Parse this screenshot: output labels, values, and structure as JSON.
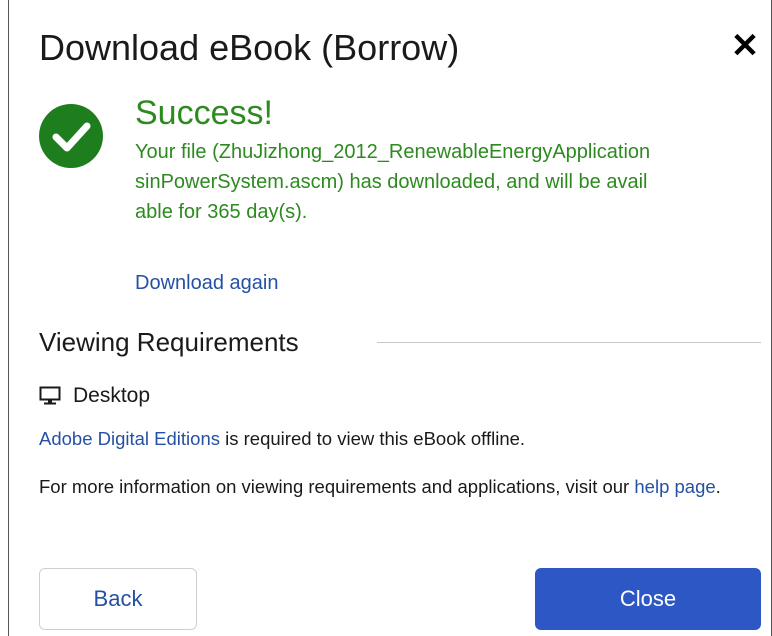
{
  "dialog": {
    "title": "Download eBook (Borrow)",
    "close_glyph": "✕",
    "close_icon": "close-icon"
  },
  "success": {
    "icon": "checkmark-circle-icon",
    "title": "Success!",
    "message": "Your file (ZhuJizhong_2012_RenewableEnergyApplicationsinPowerSystem.ascm) has downloaded, and will be available for 365 day(s).",
    "download_again_label": "Download again",
    "color": "#2c8a1f"
  },
  "requirements": {
    "heading": "Viewing Requirements",
    "platform_icon": "desktop-monitor-icon",
    "platform_label": "Desktop",
    "ade_link": "Adobe Digital Editions",
    "ade_text": " is required to view this eBook offline.",
    "info_text": "For more information on viewing requirements and applications, visit our ",
    "help_link": "help page",
    "info_end": "."
  },
  "buttons": {
    "back_label": "Back",
    "close_label": "Close"
  },
  "colors": {
    "link": "#2550a3",
    "primary": "#2d57c4",
    "success_icon_bg": "#1e7e1e"
  }
}
